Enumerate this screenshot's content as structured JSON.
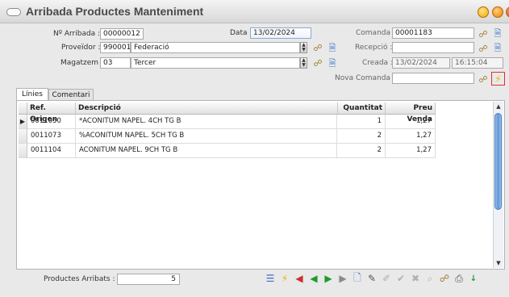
{
  "window": {
    "title": "Arribada Productes Manteniment"
  },
  "form": {
    "num_arribada": {
      "label": "Nº Arribada :",
      "value": "00000012"
    },
    "data": {
      "label": "Data :",
      "value": "13/02/2024"
    },
    "comanda": {
      "label": "Comanda :",
      "value": "00001183"
    },
    "proveidor": {
      "label": "Proveïdor :",
      "code": "990001",
      "name": "Federació"
    },
    "recepcio": {
      "label": "Recepció :",
      "value": ""
    },
    "magatzem": {
      "label": "Magatzem :",
      "code": "03",
      "name": "Tercer"
    },
    "creada": {
      "label": "Creada :",
      "date": "13/02/2024",
      "time": "16:15:04"
    },
    "nova_comanda": {
      "label": "Nova Comanda :",
      "value": ""
    }
  },
  "tabs": [
    {
      "label": "Línies"
    },
    {
      "label": "Comentari"
    }
  ],
  "table": {
    "headers": [
      "Ref. Origen",
      "Descripció",
      "Quantitat",
      "Preu Venda"
    ],
    "rows": [
      {
        "ref": "0011050",
        "desc": "*ACONITUM NAPEL. 4CH TG B",
        "qty": "1",
        "price": "1,27"
      },
      {
        "ref": "0011073",
        "desc": "%ACONITUM NAPEL. 5CH TG B",
        "qty": "2",
        "price": "1,27"
      },
      {
        "ref": "0011104",
        "desc": "ACONITUM NAPEL. 9CH TG B",
        "qty": "2",
        "price": "1,27"
      }
    ]
  },
  "footer": {
    "productes_label": "Productes Arribats :",
    "productes_value": "5"
  },
  "icons": {
    "spin_up": "▲",
    "spin_down": "▼",
    "row_pointer": "▶",
    "scroll_up": "▲",
    "scroll_down": "▼"
  },
  "colors": {
    "highlight_border": "#e03030",
    "accent_blue": "#5f93d6"
  }
}
